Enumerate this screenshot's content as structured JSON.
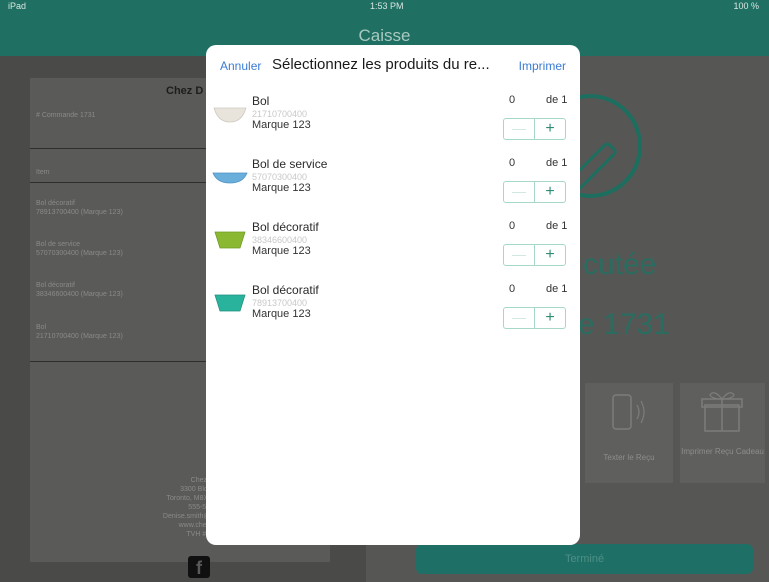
{
  "status_bar": {
    "carrier": "iPad",
    "time": "1:53 PM",
    "battery": "100 %"
  },
  "nav": {
    "title": "Caisse"
  },
  "receipt": {
    "store_name": "Chez D",
    "order_number": "# Commande 1731",
    "item_header": "Item",
    "items": [
      {
        "line1": "Bol décoratif",
        "line2": "78913700400 (Marque 123)"
      },
      {
        "line1": "Bol de service",
        "line2": "57070300400 (Marque 123)"
      },
      {
        "line1": "Bol décoratif",
        "line2": "38346600400 (Marque 123)"
      },
      {
        "line1": "Bol",
        "line2": "21710700400 (Marque 123)"
      }
    ],
    "footer": [
      "Chez D",
      "3300 Bloor",
      "Toronto, M8X 2",
      "555-555",
      "Denise.smith@c",
      "www.chezd",
      "TVH #12"
    ]
  },
  "right": {
    "executed_text": "cutée",
    "order_text": "e 1731",
    "text_receipt_label": "Texter le Reçu",
    "gift_receipt_label": "Imprimer Reçu Cadeau",
    "done_label": "Terminé"
  },
  "modal": {
    "cancel_label": "Annuler",
    "title": "Sélectionnez les produits du re...",
    "print_label": "Imprimer",
    "products": [
      {
        "name": "Bol",
        "code": "21710700400",
        "brand": "Marque 123",
        "qty": "0",
        "of": "de 1",
        "minus": "—",
        "plus": "+",
        "color": "#e8e4dc"
      },
      {
        "name": "Bol de service",
        "code": "57070300400",
        "brand": "Marque 123",
        "qty": "0",
        "of": "de 1",
        "minus": "—",
        "plus": "+",
        "color": "#6aaedb"
      },
      {
        "name": "Bol décoratif",
        "code": "38346600400",
        "brand": "Marque 123",
        "qty": "0",
        "of": "de 1",
        "minus": "—",
        "plus": "+",
        "color": "#8ab833"
      },
      {
        "name": "Bol décoratif",
        "code": "78913700400",
        "brand": "Marque 123",
        "qty": "0",
        "of": "de 1",
        "minus": "—",
        "plus": "+",
        "color": "#2ab39c"
      }
    ]
  },
  "colors": {
    "accent": "#1f6f62",
    "link": "#3a7bd5",
    "stepper_border": "#a7d7c5"
  }
}
